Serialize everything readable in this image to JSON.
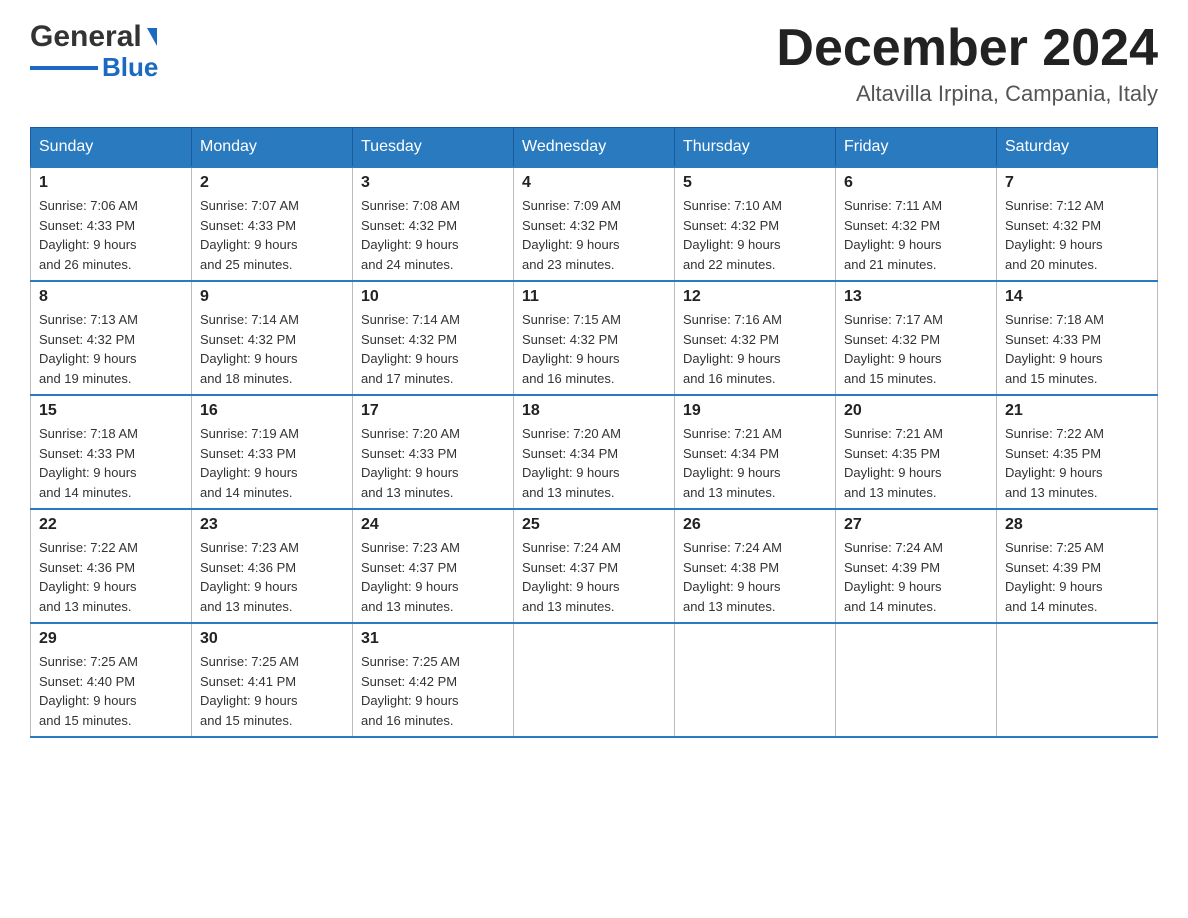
{
  "header": {
    "logo": {
      "general": "General",
      "blue": "Blue"
    },
    "title": "December 2024",
    "subtitle": "Altavilla Irpina, Campania, Italy"
  },
  "calendar": {
    "days_of_week": [
      "Sunday",
      "Monday",
      "Tuesday",
      "Wednesday",
      "Thursday",
      "Friday",
      "Saturday"
    ],
    "weeks": [
      [
        {
          "day": "1",
          "sunrise": "7:06 AM",
          "sunset": "4:33 PM",
          "daylight": "9 hours and 26 minutes."
        },
        {
          "day": "2",
          "sunrise": "7:07 AM",
          "sunset": "4:33 PM",
          "daylight": "9 hours and 25 minutes."
        },
        {
          "day": "3",
          "sunrise": "7:08 AM",
          "sunset": "4:32 PM",
          "daylight": "9 hours and 24 minutes."
        },
        {
          "day": "4",
          "sunrise": "7:09 AM",
          "sunset": "4:32 PM",
          "daylight": "9 hours and 23 minutes."
        },
        {
          "day": "5",
          "sunrise": "7:10 AM",
          "sunset": "4:32 PM",
          "daylight": "9 hours and 22 minutes."
        },
        {
          "day": "6",
          "sunrise": "7:11 AM",
          "sunset": "4:32 PM",
          "daylight": "9 hours and 21 minutes."
        },
        {
          "day": "7",
          "sunrise": "7:12 AM",
          "sunset": "4:32 PM",
          "daylight": "9 hours and 20 minutes."
        }
      ],
      [
        {
          "day": "8",
          "sunrise": "7:13 AM",
          "sunset": "4:32 PM",
          "daylight": "9 hours and 19 minutes."
        },
        {
          "day": "9",
          "sunrise": "7:14 AM",
          "sunset": "4:32 PM",
          "daylight": "9 hours and 18 minutes."
        },
        {
          "day": "10",
          "sunrise": "7:14 AM",
          "sunset": "4:32 PM",
          "daylight": "9 hours and 17 minutes."
        },
        {
          "day": "11",
          "sunrise": "7:15 AM",
          "sunset": "4:32 PM",
          "daylight": "9 hours and 16 minutes."
        },
        {
          "day": "12",
          "sunrise": "7:16 AM",
          "sunset": "4:32 PM",
          "daylight": "9 hours and 16 minutes."
        },
        {
          "day": "13",
          "sunrise": "7:17 AM",
          "sunset": "4:32 PM",
          "daylight": "9 hours and 15 minutes."
        },
        {
          "day": "14",
          "sunrise": "7:18 AM",
          "sunset": "4:33 PM",
          "daylight": "9 hours and 15 minutes."
        }
      ],
      [
        {
          "day": "15",
          "sunrise": "7:18 AM",
          "sunset": "4:33 PM",
          "daylight": "9 hours and 14 minutes."
        },
        {
          "day": "16",
          "sunrise": "7:19 AM",
          "sunset": "4:33 PM",
          "daylight": "9 hours and 14 minutes."
        },
        {
          "day": "17",
          "sunrise": "7:20 AM",
          "sunset": "4:33 PM",
          "daylight": "9 hours and 13 minutes."
        },
        {
          "day": "18",
          "sunrise": "7:20 AM",
          "sunset": "4:34 PM",
          "daylight": "9 hours and 13 minutes."
        },
        {
          "day": "19",
          "sunrise": "7:21 AM",
          "sunset": "4:34 PM",
          "daylight": "9 hours and 13 minutes."
        },
        {
          "day": "20",
          "sunrise": "7:21 AM",
          "sunset": "4:35 PM",
          "daylight": "9 hours and 13 minutes."
        },
        {
          "day": "21",
          "sunrise": "7:22 AM",
          "sunset": "4:35 PM",
          "daylight": "9 hours and 13 minutes."
        }
      ],
      [
        {
          "day": "22",
          "sunrise": "7:22 AM",
          "sunset": "4:36 PM",
          "daylight": "9 hours and 13 minutes."
        },
        {
          "day": "23",
          "sunrise": "7:23 AM",
          "sunset": "4:36 PM",
          "daylight": "9 hours and 13 minutes."
        },
        {
          "day": "24",
          "sunrise": "7:23 AM",
          "sunset": "4:37 PM",
          "daylight": "9 hours and 13 minutes."
        },
        {
          "day": "25",
          "sunrise": "7:24 AM",
          "sunset": "4:37 PM",
          "daylight": "9 hours and 13 minutes."
        },
        {
          "day": "26",
          "sunrise": "7:24 AM",
          "sunset": "4:38 PM",
          "daylight": "9 hours and 13 minutes."
        },
        {
          "day": "27",
          "sunrise": "7:24 AM",
          "sunset": "4:39 PM",
          "daylight": "9 hours and 14 minutes."
        },
        {
          "day": "28",
          "sunrise": "7:25 AM",
          "sunset": "4:39 PM",
          "daylight": "9 hours and 14 minutes."
        }
      ],
      [
        {
          "day": "29",
          "sunrise": "7:25 AM",
          "sunset": "4:40 PM",
          "daylight": "9 hours and 15 minutes."
        },
        {
          "day": "30",
          "sunrise": "7:25 AM",
          "sunset": "4:41 PM",
          "daylight": "9 hours and 15 minutes."
        },
        {
          "day": "31",
          "sunrise": "7:25 AM",
          "sunset": "4:42 PM",
          "daylight": "9 hours and 16 minutes."
        },
        null,
        null,
        null,
        null
      ]
    ],
    "labels": {
      "sunrise": "Sunrise:",
      "sunset": "Sunset:",
      "daylight": "Daylight:"
    }
  }
}
